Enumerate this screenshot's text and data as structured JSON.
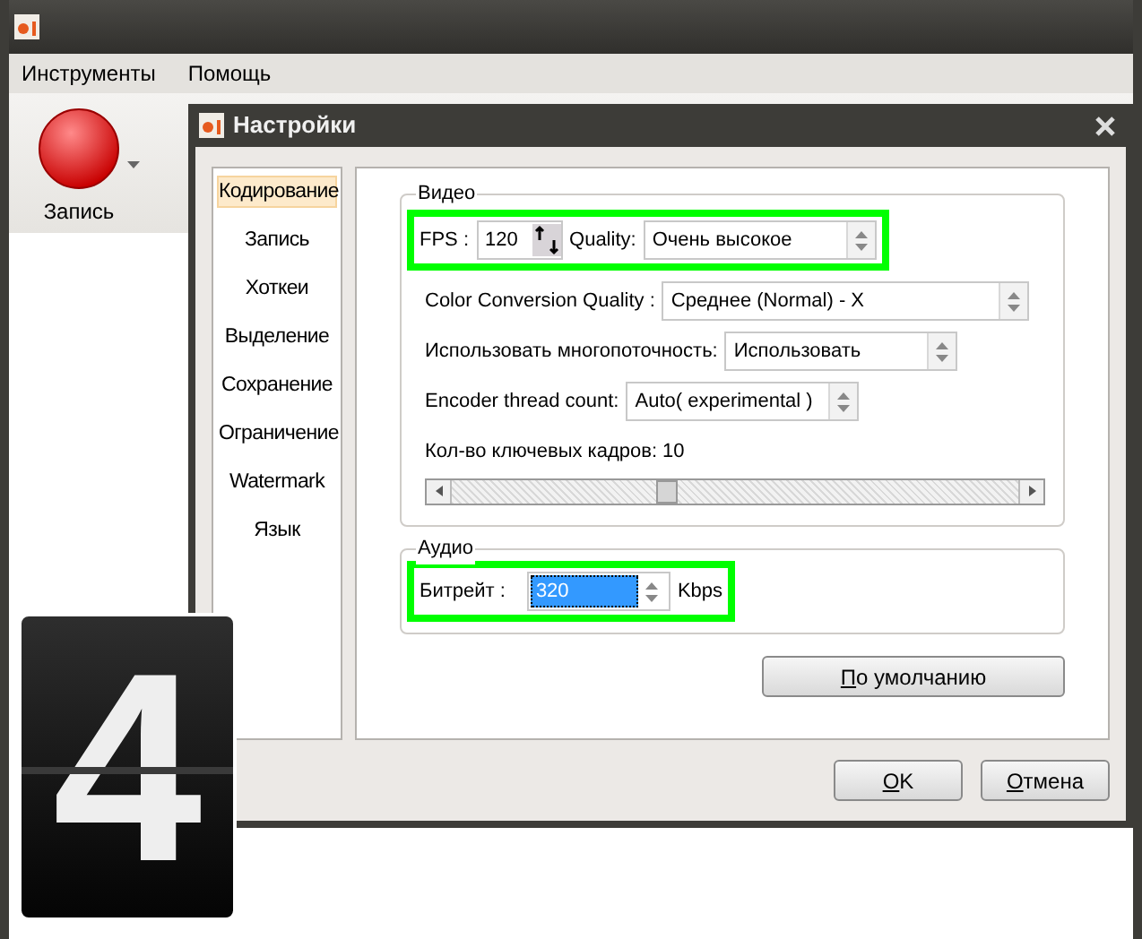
{
  "main_window": {
    "menu": [
      "Инструменты",
      "Помощь"
    ],
    "record_button": {
      "label": "Запись"
    }
  },
  "dialog": {
    "title": "Настройки",
    "sidebar": [
      {
        "label": "Кодирование",
        "selected": true
      },
      {
        "label": "Запись",
        "selected": false
      },
      {
        "label": "Хоткеи",
        "selected": false
      },
      {
        "label": "Выделение",
        "selected": false
      },
      {
        "label": "Сохранение",
        "selected": false
      },
      {
        "label": "Ограничение",
        "selected": false
      },
      {
        "label": "Watermark",
        "selected": false
      },
      {
        "label": "Язык",
        "selected": false
      }
    ],
    "video": {
      "title": "Видео",
      "highlighted": true,
      "fps_label": "FPS :",
      "fps_value": "120",
      "quality_label": "Quality:",
      "quality_value": "Очень высокое",
      "rows": [
        {
          "label": "Color Conversion Quality :",
          "value": "Среднее (Normal) - X",
          "kind": "wide"
        },
        {
          "label": "Использовать многопоточность:",
          "value": "Использовать",
          "kind": "short"
        },
        {
          "label": "Encoder thread count:",
          "value": "Auto( experimental )",
          "kind": "short"
        }
      ],
      "keyframes": "Кол-во ключевых кадров: 10",
      "keyframes_slider": {
        "level": 0.38
      }
    },
    "audio": {
      "title": "Аудио",
      "highlighted": true,
      "bitrate_label": "Битрейт :",
      "bitrate_value": "320",
      "unit": "Kbps"
    },
    "defaults_button": "По умолчанию",
    "buttons": [
      "OK",
      "Отмена"
    ]
  },
  "step_badge": "4"
}
